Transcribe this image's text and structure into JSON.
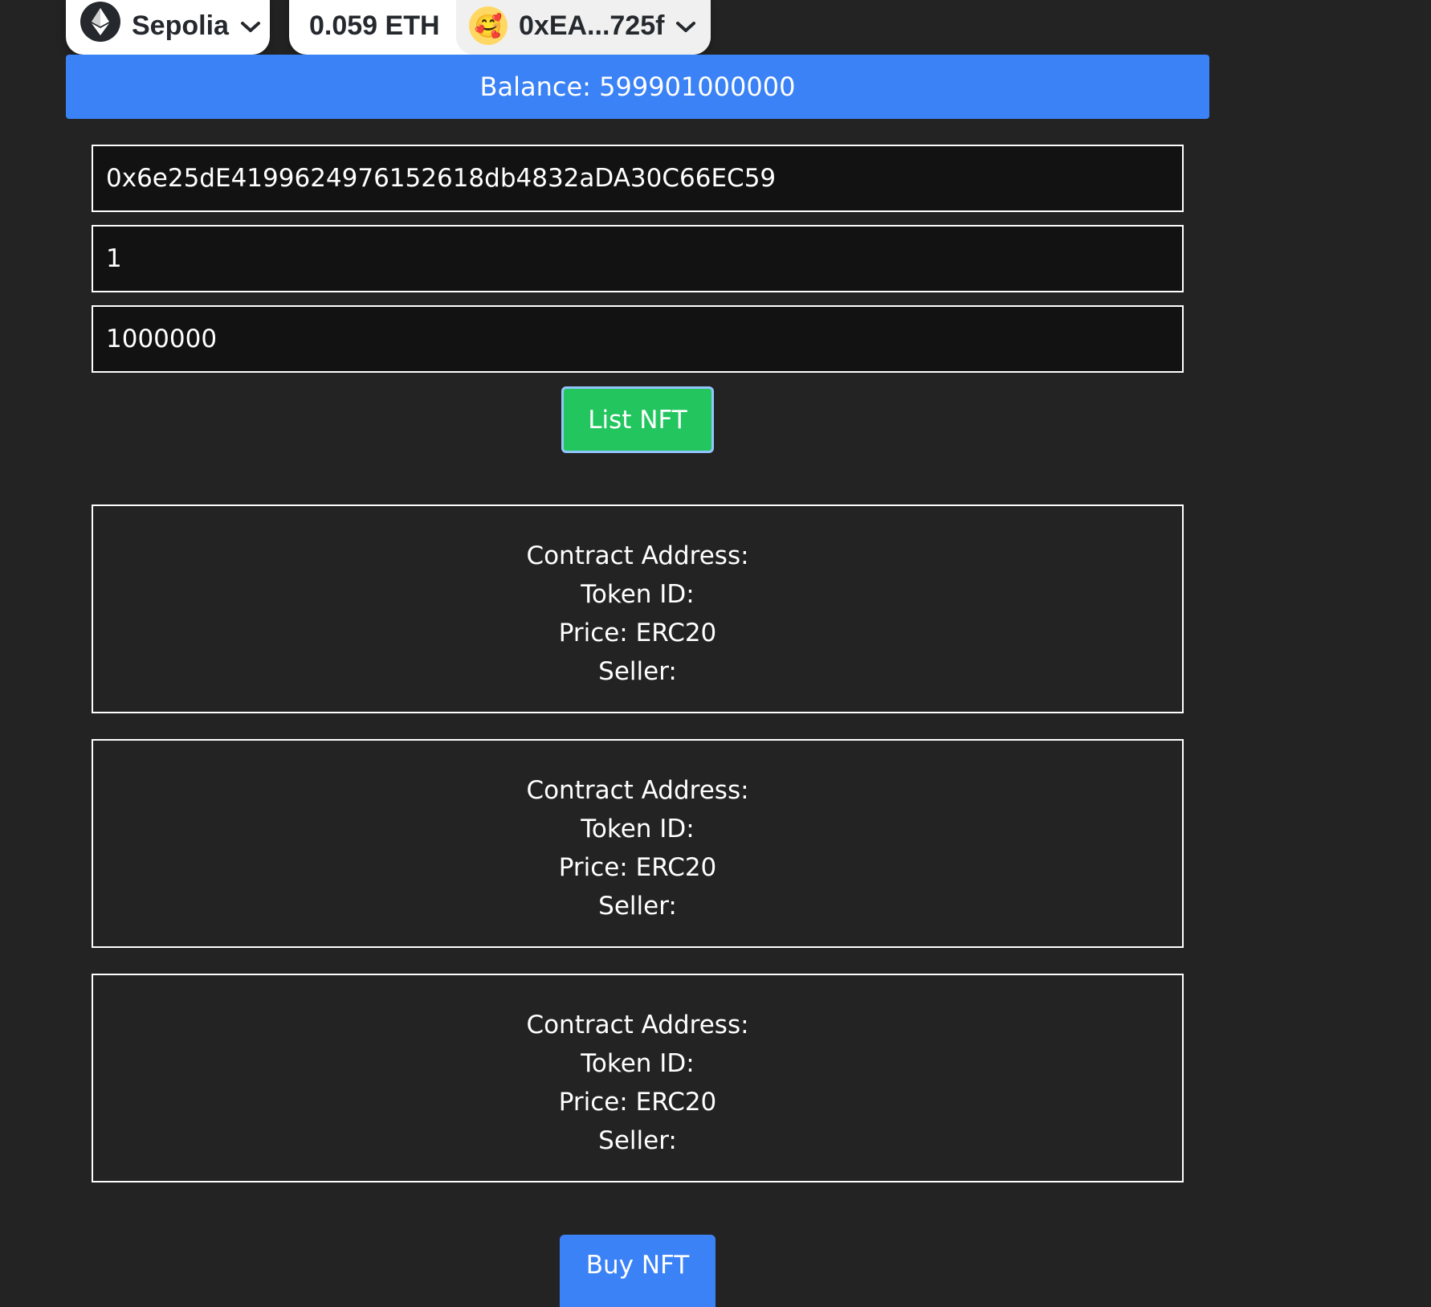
{
  "wallet": {
    "chain_name": "Sepolia",
    "chain_icon": "ethereum-icon",
    "balance": "0.059 ETH",
    "account_address": "0xEA...725f",
    "avatar_emoji": "🥰"
  },
  "balance_bar": {
    "text": "Balance: 599901000000"
  },
  "form": {
    "contract_address_value": "0x6e25dE4199624976152618db4832aDA30C66EC59",
    "token_id_value": "1",
    "price_value": "1000000",
    "list_button_label": "List NFT"
  },
  "listings": [
    {
      "contract_label": "Contract Address:",
      "token_label": "Token ID:",
      "price_label": "Price: ERC20",
      "seller_label": "Seller:"
    },
    {
      "contract_label": "Contract Address:",
      "token_label": "Token ID:",
      "price_label": "Price: ERC20",
      "seller_label": "Seller:"
    },
    {
      "contract_label": "Contract Address:",
      "token_label": "Token ID:",
      "price_label": "Price: ERC20",
      "seller_label": "Seller:"
    }
  ],
  "buy_button_label": "Buy NFT",
  "colors": {
    "background": "#232323",
    "accent_blue": "#3b82f6",
    "list_green": "#22c55e"
  }
}
